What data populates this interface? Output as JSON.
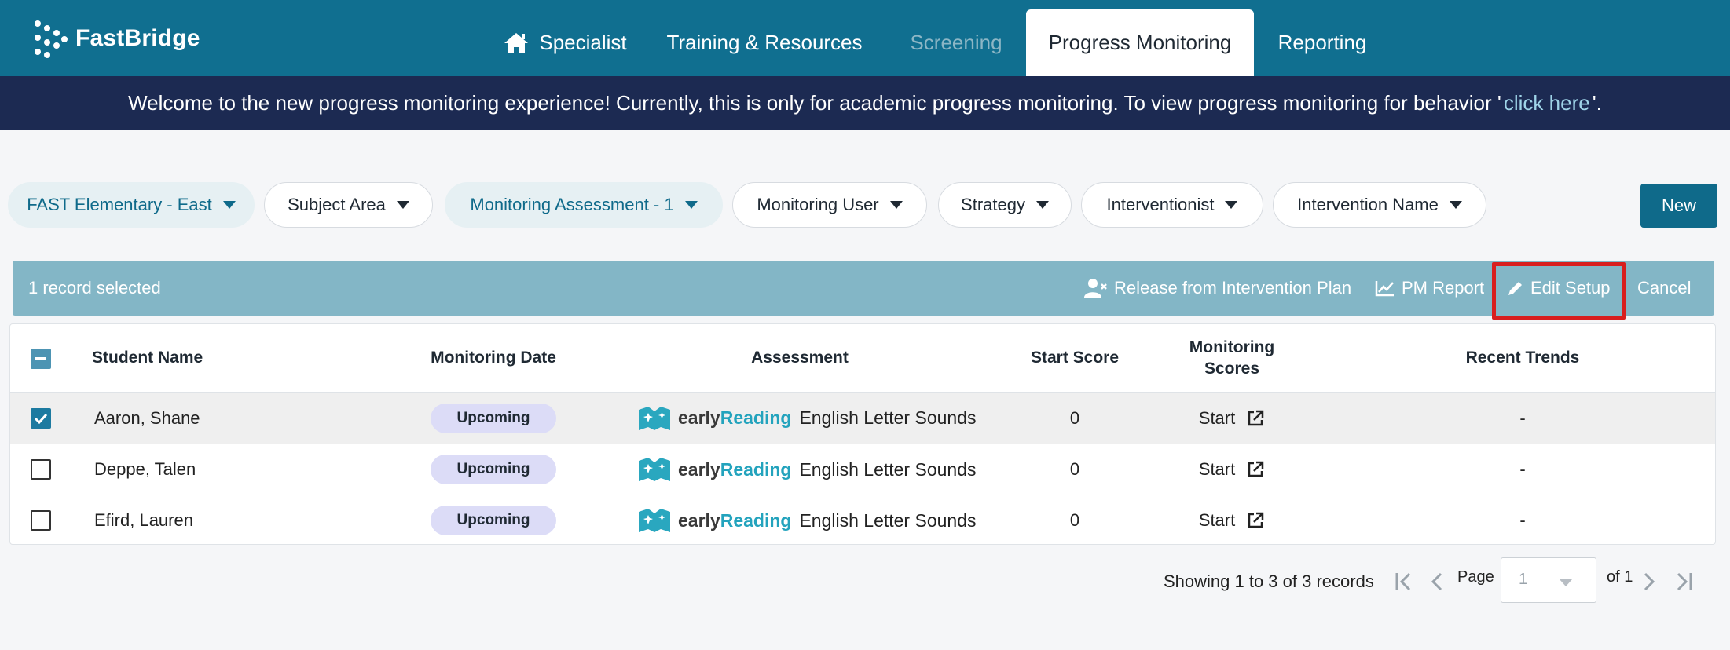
{
  "app": {
    "logo_text": "FastBridge",
    "nav": [
      {
        "label": "Specialist",
        "icon": "home-icon"
      },
      {
        "label": "Training & Resources"
      },
      {
        "label": "Screening"
      },
      {
        "label": "Progress Monitoring"
      },
      {
        "label": "Reporting"
      }
    ],
    "active_tab": "Progress Monitoring"
  },
  "banner": {
    "text_before": "Welcome to the new progress monitoring experience! Currently, this is only for academic progress monitoring. To view progress monitoring for behavior '",
    "link": "click here",
    "text_after": "'."
  },
  "filters": [
    {
      "label": "FAST Elementary - East",
      "selected": true
    },
    {
      "label": "Subject Area",
      "selected": false
    },
    {
      "label": "Monitoring Assessment - 1",
      "selected": true
    },
    {
      "label": "Monitoring User",
      "selected": false
    },
    {
      "label": "Strategy",
      "selected": false
    },
    {
      "label": "Interventionist",
      "selected": false
    },
    {
      "label": "Intervention Name",
      "selected": false
    }
  ],
  "new_button": "New",
  "action_bar": {
    "selected_count": "1 record selected",
    "release": "Release from Intervention Plan",
    "pm_report": "PM Report",
    "edit_setup": "Edit Setup",
    "cancel": "Cancel"
  },
  "table": {
    "headers": {
      "student_name": "Student Name",
      "monitoring_date": "Monitoring Date",
      "assessment": "Assessment",
      "start_score": "Start Score",
      "monitoring_scores_1": "Monitoring",
      "monitoring_scores_2": "Scores",
      "recent_trends": "Recent Trends"
    },
    "rows": [
      {
        "name": "Aaron, Shane",
        "status": "Upcoming",
        "brand_1": "early",
        "brand_2": "Reading",
        "assessment": "English Letter Sounds",
        "start_score": "0",
        "scores": "Start",
        "trend": "-",
        "checked": true
      },
      {
        "name": "Deppe, Talen",
        "status": "Upcoming",
        "brand_1": "early",
        "brand_2": "Reading",
        "assessment": "English Letter Sounds",
        "start_score": "0",
        "scores": "Start",
        "trend": "-",
        "checked": false
      },
      {
        "name": "Efird, Lauren",
        "status": "Upcoming",
        "brand_1": "early",
        "brand_2": "Reading",
        "assessment": "English Letter Sounds",
        "start_score": "0",
        "scores": "Start",
        "trend": "-",
        "checked": false
      }
    ]
  },
  "pagination": {
    "showing": "Showing 1 to 3 of 3 records",
    "page_label": "Page",
    "page_value": "1",
    "of_label": "of 1"
  },
  "colors": {
    "nav_bg": "#106f90",
    "banner_bg": "#1c2a52",
    "action_bar_bg": "#83b6c6",
    "accent": "#0f6a8a",
    "highlight": "#d81e1e"
  }
}
